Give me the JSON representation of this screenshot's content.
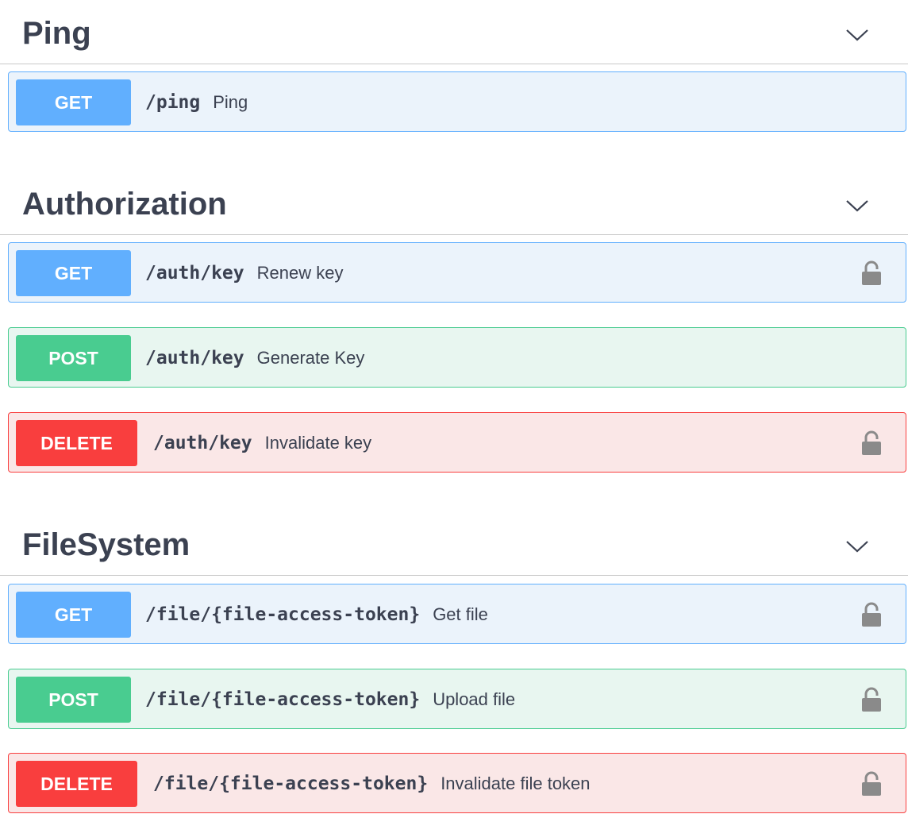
{
  "sections": [
    {
      "title": "Ping",
      "operations": [
        {
          "method": "GET",
          "path": "/ping",
          "summary": "Ping",
          "locked": false
        }
      ]
    },
    {
      "title": "Authorization",
      "operations": [
        {
          "method": "GET",
          "path": "/auth/key",
          "summary": "Renew key",
          "locked": true
        },
        {
          "method": "POST",
          "path": "/auth/key",
          "summary": "Generate Key",
          "locked": false
        },
        {
          "method": "DELETE",
          "path": "/auth/key",
          "summary": "Invalidate key",
          "locked": true
        }
      ]
    },
    {
      "title": "FileSystem",
      "operations": [
        {
          "method": "GET",
          "path": "/file/{file-access-token}",
          "summary": "Get file",
          "locked": true
        },
        {
          "method": "POST",
          "path": "/file/{file-access-token}",
          "summary": "Upload file",
          "locked": true
        },
        {
          "method": "DELETE",
          "path": "/file/{file-access-token}",
          "summary": "Invalidate file token",
          "locked": true
        }
      ]
    }
  ],
  "icons": {
    "section_toggle": "chevron-down-icon",
    "auth": "lock-icon"
  },
  "colors": {
    "get": "#61affe",
    "post": "#49cc90",
    "delete": "#f93e3e",
    "text": "#3b4151",
    "lock": "#8a8a8a"
  }
}
